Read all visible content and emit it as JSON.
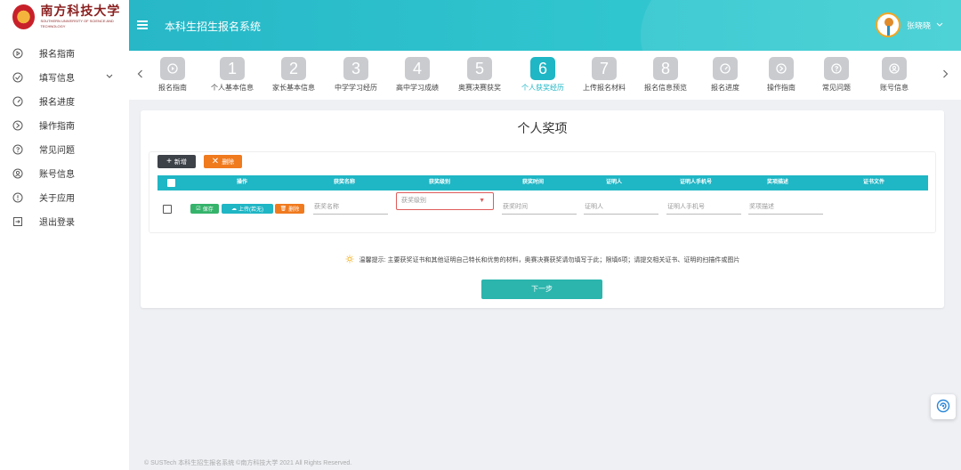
{
  "brand": {
    "cn": "南方科技大学",
    "en": "SOUTHERN UNIVERSITY OF SCIENCE AND TECHNOLOGY"
  },
  "sidebar": {
    "items": [
      {
        "label": "报名指南",
        "icon": "play-circle-icon"
      },
      {
        "label": "填写信息",
        "icon": "check-circle-icon",
        "caret": "⌄"
      },
      {
        "label": "报名进度",
        "icon": "gauge-icon"
      },
      {
        "label": "操作指南",
        "icon": "guide-circle-icon"
      },
      {
        "label": "常见问题",
        "icon": "question-circle-icon"
      },
      {
        "label": "账号信息",
        "icon": "user-circle-icon"
      },
      {
        "label": "关于应用",
        "icon": "info-circle-icon"
      },
      {
        "label": "退出登录",
        "icon": "logout-icon"
      }
    ]
  },
  "header": {
    "title": "本科生招生报名系统",
    "user_name": "张晓晓",
    "user_caret": "⌄"
  },
  "steps": {
    "items": [
      {
        "num": "",
        "label": "报名指南",
        "icon": "play-circle-icon"
      },
      {
        "num": "1",
        "label": "个人基本信息"
      },
      {
        "num": "2",
        "label": "家长基本信息"
      },
      {
        "num": "3",
        "label": "中学学习经历"
      },
      {
        "num": "4",
        "label": "高中学习成绩"
      },
      {
        "num": "5",
        "label": "奥赛决赛获奖"
      },
      {
        "num": "6",
        "label": "个人获奖经历",
        "active": true
      },
      {
        "num": "7",
        "label": "上传报名材料"
      },
      {
        "num": "8",
        "label": "报名信息预览"
      },
      {
        "num": "",
        "label": "报名进度",
        "icon": "gauge-icon"
      },
      {
        "num": "",
        "label": "操作指南",
        "icon": "guide-circle-icon"
      },
      {
        "num": "",
        "label": "常见问题",
        "icon": "question-circle-icon"
      },
      {
        "num": "",
        "label": "账号信息",
        "icon": "user-circle-icon"
      }
    ],
    "active_color": "#1fb6c5",
    "inactive_color": "#c9cbcf"
  },
  "main": {
    "title": "个人奖项",
    "toolbar": {
      "add_label": "新增",
      "delete_label": "删除"
    },
    "table": {
      "headers": [
        "操作",
        "获奖名称",
        "获奖级别",
        "获奖时间",
        "证明人",
        "证明人手机号",
        "奖项描述",
        "证书文件"
      ],
      "row": {
        "save_label": "保存",
        "upload_label": "上传(若无)",
        "delete_label": "删除",
        "award_name_placeholder": "获奖名称",
        "award_level_placeholder": "获奖级别",
        "award_time_placeholder": "获奖时间",
        "witness_placeholder": "证明人",
        "witness_phone_placeholder": "证明人手机号",
        "description_placeholder": "奖项描述"
      }
    },
    "tip": "温馨提示: 主要获奖证书和其他证明自己特长和优势的材料，奥赛决赛获奖请勿填写于此；限填6项；请提交相关证书、证明的扫描件或图片",
    "next_label": "下一步"
  },
  "footer": {
    "text": "© SUSTech 本科生招生报名系统 ©南方科技大学 2021 All Rights Reserved."
  },
  "colors": {
    "accent": "#1fb6c5",
    "orange": "#f07a1e",
    "green": "#35b36b",
    "dark": "#3d4148",
    "next": "#2bb5ad"
  }
}
